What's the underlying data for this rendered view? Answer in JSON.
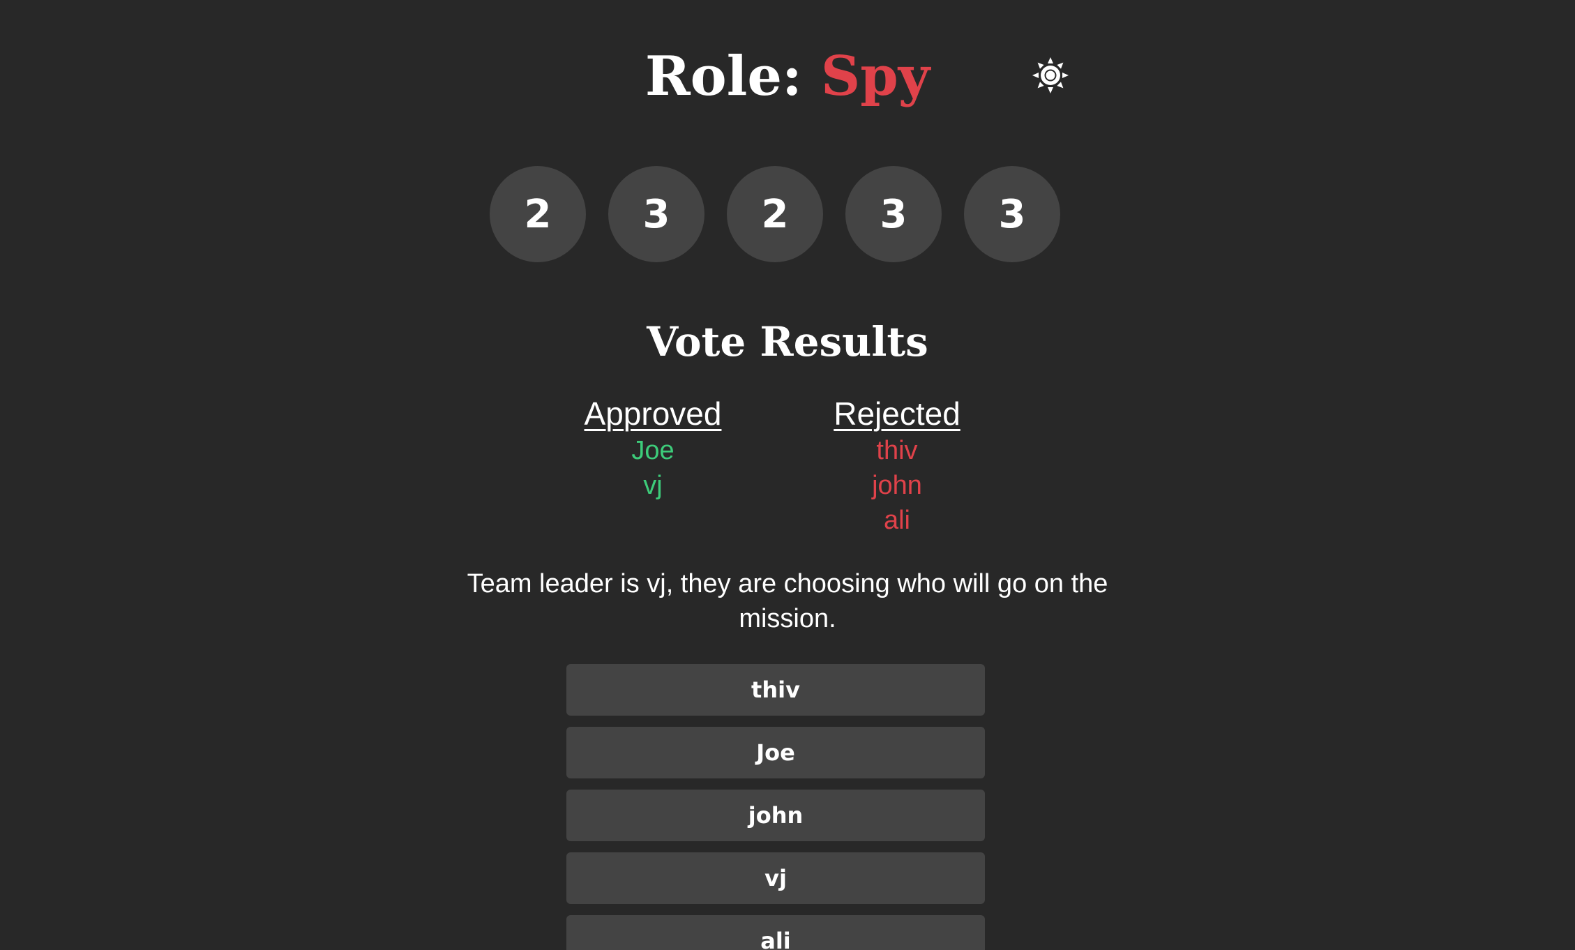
{
  "header": {
    "role_label": "Role:",
    "role_value": "Spy",
    "theme_icon": "sun-icon"
  },
  "missions": [
    "2",
    "3",
    "2",
    "3",
    "3"
  ],
  "vote_results": {
    "title": "Vote Results",
    "approved": {
      "heading": "Approved",
      "names": [
        "Joe",
        "vj"
      ]
    },
    "rejected": {
      "heading": "Rejected",
      "names": [
        "thiv",
        "john",
        "ali"
      ]
    }
  },
  "status_text": "Team leader is vj, they are choosing who will go on the mission.",
  "players": [
    "thiv",
    "Joe",
    "john",
    "vj",
    "ali"
  ],
  "colors": {
    "background": "#282828",
    "surface": "#444444",
    "spy_red": "#e0424a",
    "approve_green": "#3dcc7a"
  }
}
